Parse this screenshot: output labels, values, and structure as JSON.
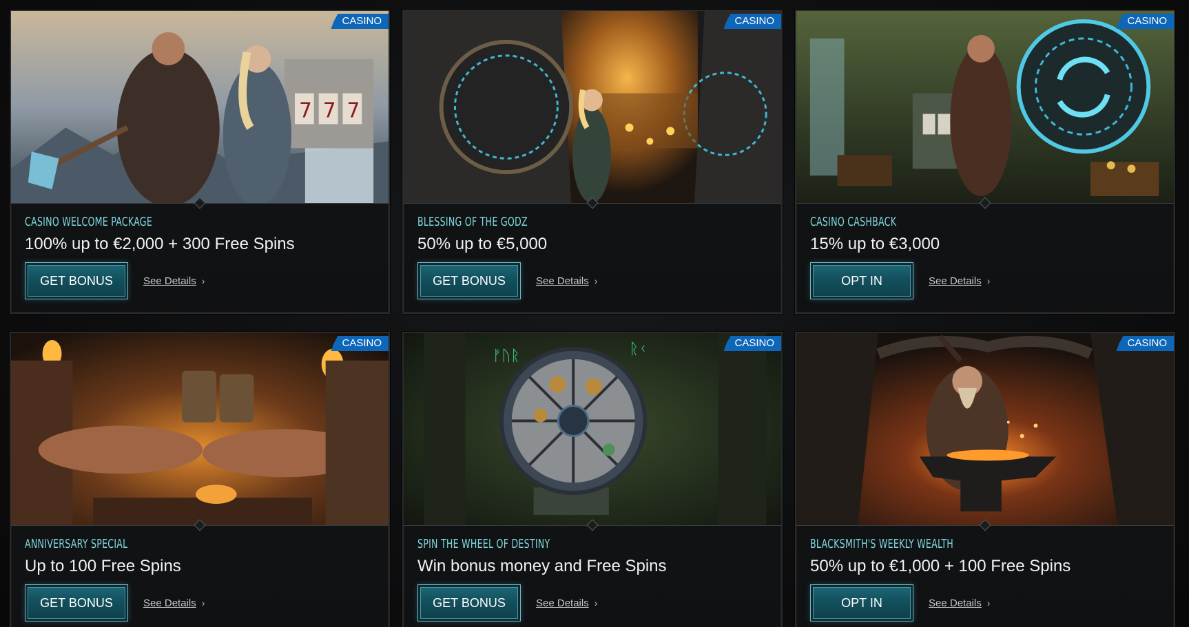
{
  "cards": [
    {
      "badge": "CASINO",
      "kicker": "CASINO WELCOME PACKAGE",
      "headline": "100% up to €2,000 + 300 Free Spins",
      "cta": "GET BONUS",
      "details": "See Details",
      "scene": "viking-warriors"
    },
    {
      "badge": "CASINO",
      "kicker": "BLESSING OF THE GODZ",
      "headline": "50% up to €5,000",
      "cta": "GET BONUS",
      "details": "See Details",
      "scene": "treasure-vault"
    },
    {
      "badge": "CASINO",
      "kicker": "CASINO CASHBACK",
      "headline": "15% up to €3,000",
      "cta": "OPT IN",
      "details": "See Details",
      "scene": "rune-portal"
    },
    {
      "badge": "CASINO",
      "kicker": "ANNIVERSARY SPECIAL",
      "headline": "Up to 100 Free Spins",
      "cta": "GET BONUS",
      "details": "See Details",
      "scene": "feast-toast"
    },
    {
      "badge": "CASINO",
      "kicker": "SPIN THE WHEEL OF DESTINY",
      "headline": "Win bonus money and Free Spins",
      "cta": "GET BONUS",
      "details": "See Details",
      "scene": "wheel-forest"
    },
    {
      "badge": "CASINO",
      "kicker": "BLACKSMITH'S WEEKLY WEALTH",
      "headline": "50% up to €1,000 + 100 Free Spins",
      "cta": "OPT IN",
      "details": "See Details",
      "scene": "blacksmith-forge"
    }
  ],
  "colors": {
    "badge": "#0d66b8",
    "kicker": "#7fd8de",
    "cta": "#13505d"
  }
}
